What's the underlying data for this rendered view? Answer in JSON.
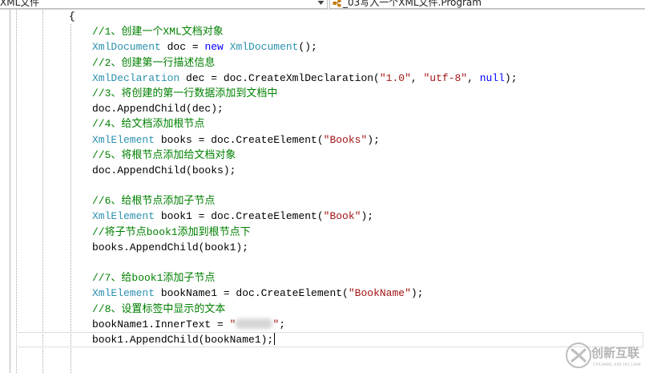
{
  "toolbar": {
    "type_dropdown": {
      "label": "XML文件",
      "arrow_icon": "chevron-down-icon"
    },
    "member_dropdown": {
      "label": "_03写入一个XML文件.Program",
      "icon": "class-icon"
    }
  },
  "colors": {
    "comment": "#008000",
    "type": "#2b91af",
    "keyword": "#0000ff",
    "string": "#a31515",
    "plain": "#000000",
    "current_line_border": "#dedede"
  },
  "editor": {
    "open_brace": "{",
    "lines": [
      {
        "tokens": [
          {
            "comment": "//1、创建一个XML文档对象"
          }
        ]
      },
      {
        "tokens": [
          {
            "type": "XmlDocument"
          },
          {
            "plain": " doc = "
          },
          {
            "keyword": "new"
          },
          {
            "plain": " "
          },
          {
            "type": "XmlDocument"
          },
          {
            "plain": "();"
          }
        ]
      },
      {
        "tokens": [
          {
            "comment": "//2、创建第一行描述信息"
          }
        ]
      },
      {
        "tokens": [
          {
            "type": "XmlDeclaration"
          },
          {
            "plain": " dec = doc.CreateXmlDeclaration("
          },
          {
            "string": "\"1.0\""
          },
          {
            "plain": ", "
          },
          {
            "string": "\"utf-8\""
          },
          {
            "plain": ", "
          },
          {
            "keyword": "null"
          },
          {
            "plain": ");"
          }
        ]
      },
      {
        "tokens": [
          {
            "comment": "//3、将创建的第一行数据添加到文档中"
          }
        ]
      },
      {
        "tokens": [
          {
            "plain": "doc.AppendChild(dec);"
          }
        ]
      },
      {
        "tokens": [
          {
            "comment": "//4、给文档添加根节点"
          }
        ]
      },
      {
        "tokens": [
          {
            "type": "XmlElement"
          },
          {
            "plain": " books = doc.CreateElement("
          },
          {
            "string": "\"Books\""
          },
          {
            "plain": ");"
          }
        ]
      },
      {
        "tokens": [
          {
            "comment": "//5、将根节点添加给文档对象"
          }
        ]
      },
      {
        "tokens": [
          {
            "plain": "doc.AppendChild(books);"
          }
        ]
      },
      {
        "tokens": []
      },
      {
        "tokens": [
          {
            "comment": "//6、给根节点添加子节点"
          }
        ]
      },
      {
        "tokens": [
          {
            "type": "XmlElement"
          },
          {
            "plain": " book1 = doc.CreateElement("
          },
          {
            "string": "\"Book\""
          },
          {
            "plain": ");"
          }
        ]
      },
      {
        "tokens": [
          {
            "comment": "//将子节点book1添加到根节点下"
          }
        ]
      },
      {
        "tokens": [
          {
            "plain": "books.AppendChild(book1);"
          }
        ]
      },
      {
        "tokens": []
      },
      {
        "tokens": [
          {
            "comment": "//7、给book1添加子节点"
          }
        ]
      },
      {
        "tokens": [
          {
            "type": "XmlElement"
          },
          {
            "plain": " bookName1 = doc.CreateElement("
          },
          {
            "string": "\"BookName\""
          },
          {
            "plain": ");"
          }
        ]
      },
      {
        "tokens": [
          {
            "comment": "//8、设置标签中显示的文本"
          }
        ]
      },
      {
        "tokens": [
          {
            "plain": "bookName1.InnerText = "
          },
          {
            "string": "\""
          },
          {
            "redacted": true
          },
          {
            "string": "\""
          },
          {
            "plain": ";"
          }
        ]
      },
      {
        "current": true,
        "tokens": [
          {
            "plain": "book1.AppendChild(bookName1);"
          }
        ]
      }
    ]
  },
  "watermark": {
    "brand": "创新互联",
    "pinyin": "CHUANG XIN HU LIAN",
    "icon": "logo-icon"
  }
}
